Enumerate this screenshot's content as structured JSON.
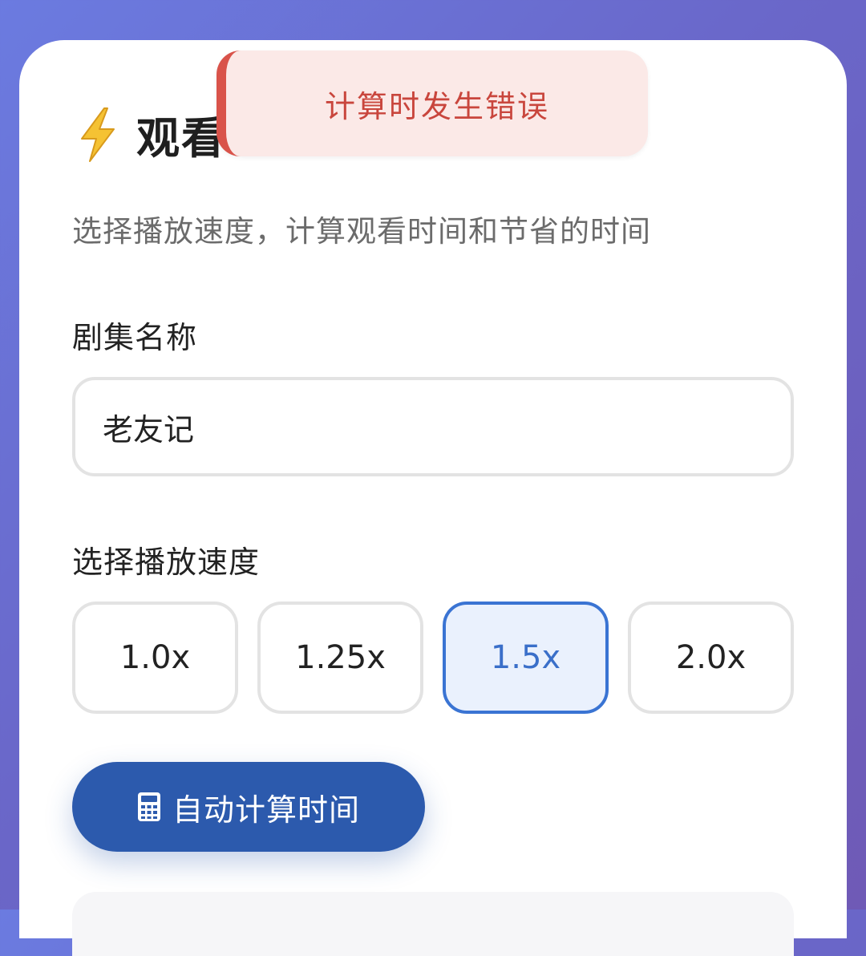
{
  "header": {
    "icon": "lightning-bolt-icon",
    "title": "观看"
  },
  "subtitle": "选择播放速度，计算观看时间和节省的时间",
  "show_field": {
    "label": "剧集名称",
    "value": "老友记"
  },
  "speed": {
    "label": "选择播放速度",
    "options": [
      "1.0x",
      "1.25x",
      "1.5x",
      "2.0x"
    ],
    "selected": "1.5x"
  },
  "calc_button": {
    "icon": "calculator-icon",
    "label": "自动计算时间"
  },
  "toast": {
    "message": "计算时发生错误"
  },
  "colors": {
    "accent": "#2c5aad",
    "selected_border": "#3a74d3",
    "error": "#d9534a"
  }
}
